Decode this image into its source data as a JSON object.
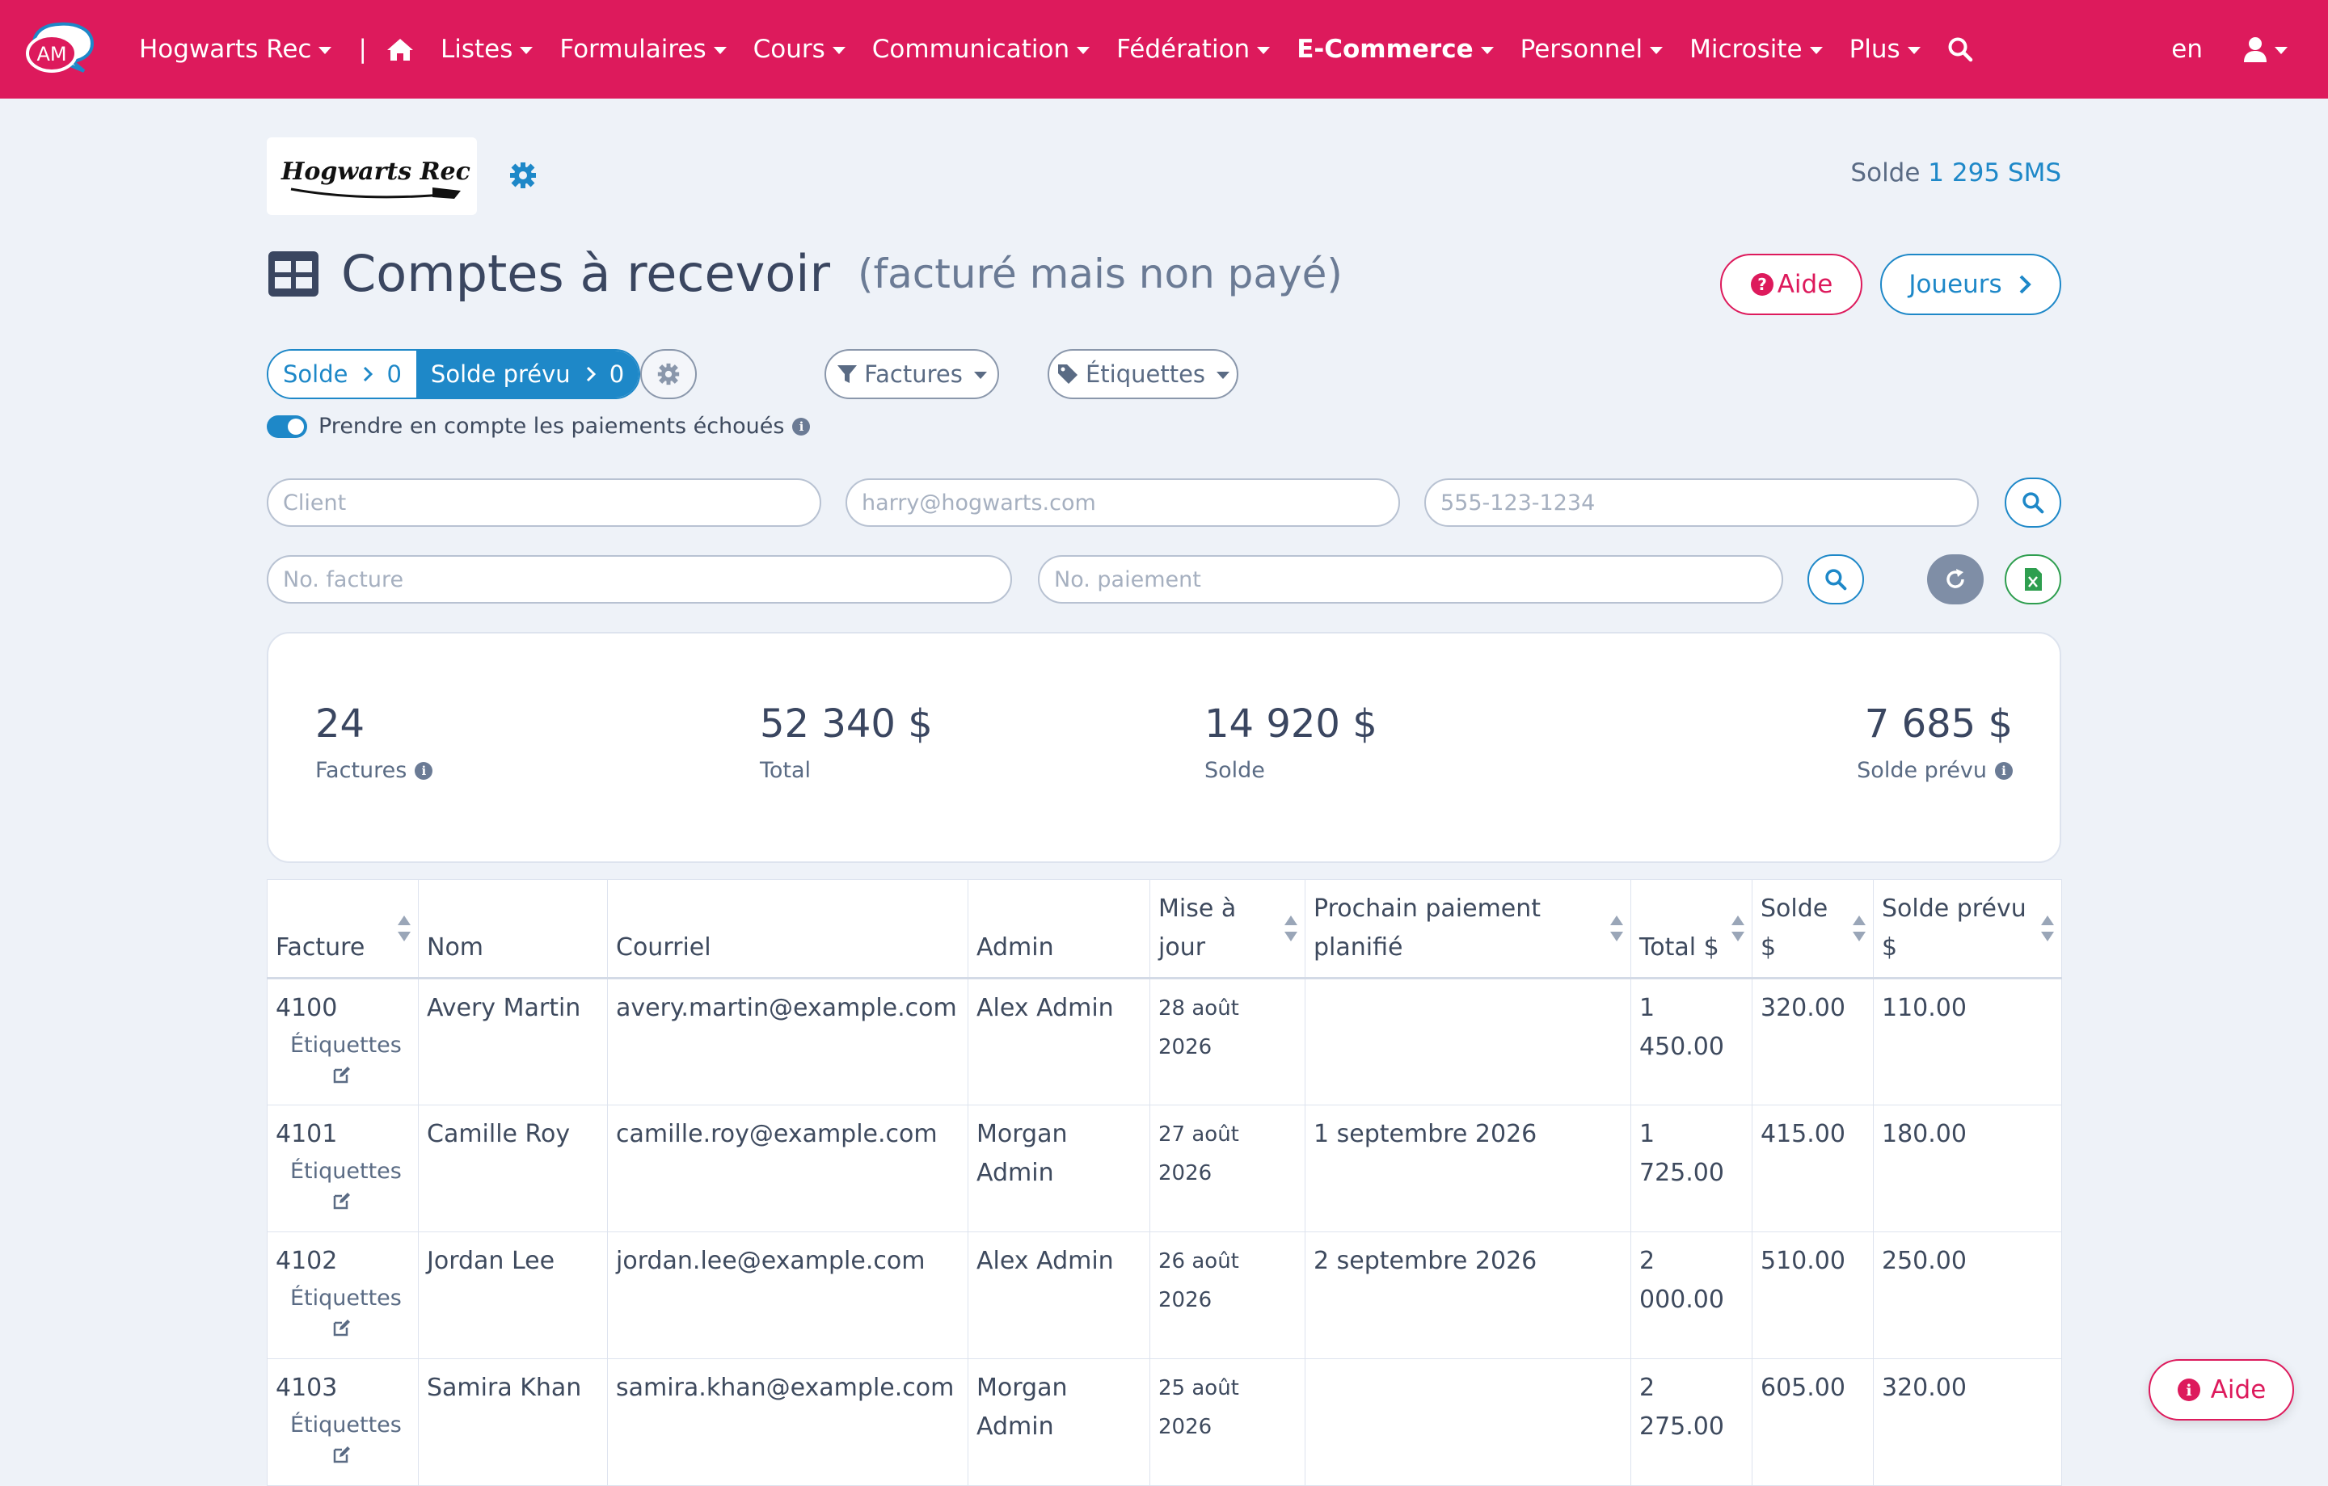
{
  "nav": {
    "brand_text": "AM",
    "org": "Hogwarts Rec",
    "separator": "|",
    "items": [
      {
        "label": "Listes"
      },
      {
        "label": "Formulaires"
      },
      {
        "label": "Cours"
      },
      {
        "label": "Communication"
      },
      {
        "label": "Fédération"
      },
      {
        "label": "E-Commerce"
      },
      {
        "label": "Personnel"
      },
      {
        "label": "Microsite"
      },
      {
        "label": "Plus"
      }
    ],
    "lang": "en",
    "icons": [
      "home-icon",
      "search-icon",
      "user-icon"
    ],
    "bg_color": "#dd1a5c"
  },
  "header": {
    "logo_text": "Hogwarts Rec",
    "sms_label": "Solde",
    "sms_value": "1 295 SMS",
    "title": "Comptes à recevoir",
    "subtitle": "(facturé mais non payé)",
    "aide": "Aide",
    "joueurs": "Joueurs"
  },
  "toolbar": {
    "solde_label": "Solde",
    "solde_value": "0",
    "solde_prevu_label": "Solde prévu",
    "solde_prevu_value": "0",
    "factures": "Factures",
    "etiquettes": "Étiquettes",
    "toggle_label": "Prendre en compte les paiements échoués",
    "toggle_on": true
  },
  "filters": {
    "client_placeholder": "Client",
    "email_placeholder": "harry@hogwarts.com",
    "phone_placeholder": "555-123-1234",
    "invoice_placeholder": "No. facture",
    "payment_placeholder": "No. paiement"
  },
  "stats": [
    {
      "value": "24",
      "label": "Factures",
      "info": true
    },
    {
      "value": "52 340 $",
      "label": "Total",
      "info": false
    },
    {
      "value": "14 920 $",
      "label": "Solde",
      "info": false
    },
    {
      "value": "7 685 $",
      "label": "Solde prévu",
      "info": true
    }
  ],
  "table": {
    "headers": [
      "Facture",
      "Nom",
      "Courriel",
      "Admin",
      "Mise à jour",
      "Prochain paiement planifié",
      "Total $",
      "Solde $",
      "Solde prévu $"
    ],
    "tags_label": "Étiquettes",
    "rows": [
      {
        "facture": "4100",
        "nom": "Avery Martin",
        "courriel": "avery.martin@example.com",
        "admin": "Alex Admin",
        "maj": "28 août 2026",
        "prochain": "",
        "total": "1 450.00",
        "solde": "320.00",
        "prevu": "110.00"
      },
      {
        "facture": "4101",
        "nom": "Camille Roy",
        "courriel": "camille.roy@example.com",
        "admin": "Morgan Admin",
        "maj": "27 août 2026",
        "prochain": "1 septembre 2026",
        "total": "1 725.00",
        "solde": "415.00",
        "prevu": "180.00"
      },
      {
        "facture": "4102",
        "nom": "Jordan Lee",
        "courriel": "jordan.lee@example.com",
        "admin": "Alex Admin",
        "maj": "26 août 2026",
        "prochain": "2 septembre 2026",
        "total": "2 000.00",
        "solde": "510.00",
        "prevu": "250.00"
      },
      {
        "facture": "4103",
        "nom": "Samira Khan",
        "courriel": "samira.khan@example.com",
        "admin": "Morgan Admin",
        "maj": "25 août 2026",
        "prochain": "",
        "total": "2 275.00",
        "solde": "605.00",
        "prevu": "320.00"
      }
    ]
  },
  "float_aide": "Aide"
}
